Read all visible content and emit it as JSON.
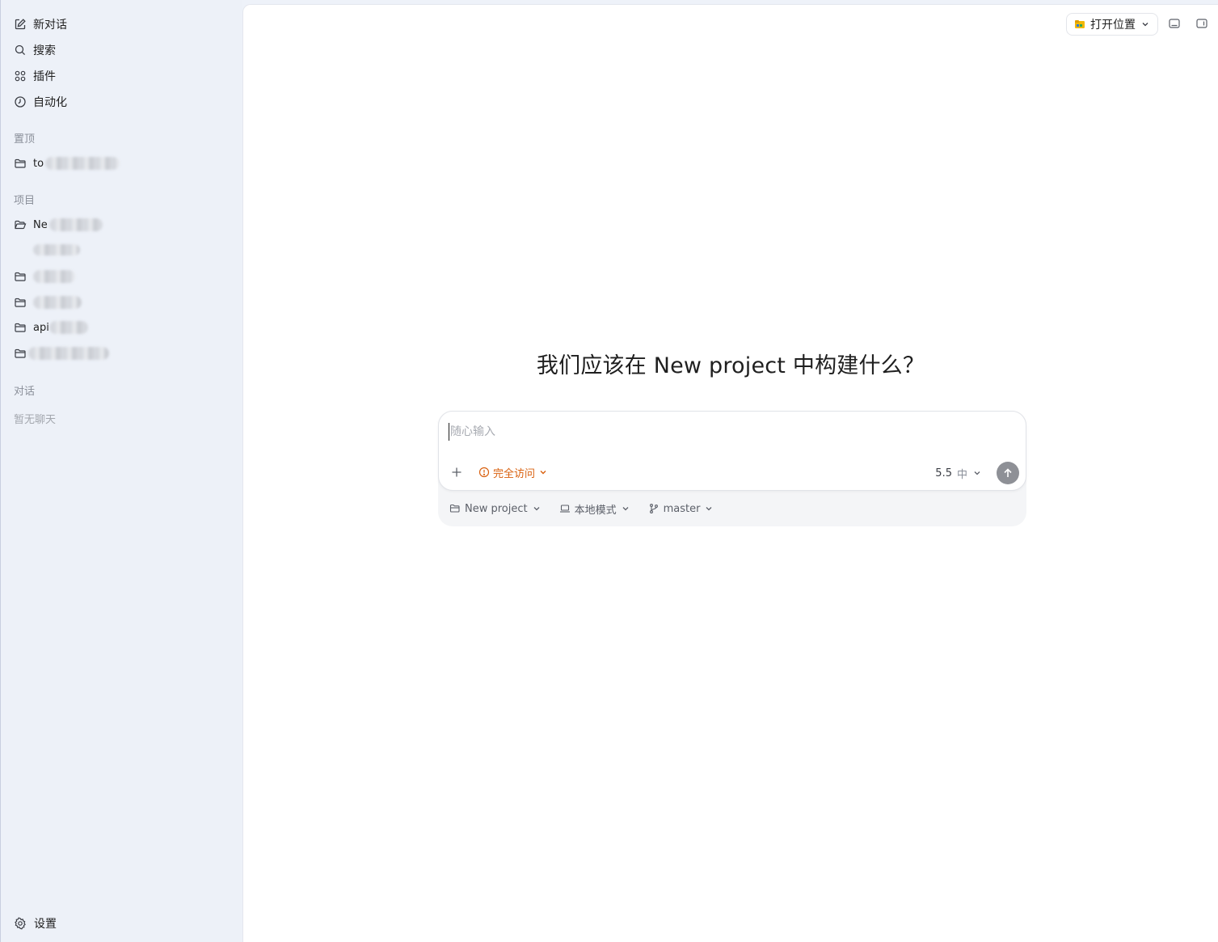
{
  "sidebar": {
    "nav": [
      {
        "label": "新对话",
        "icon": "edit-icon"
      },
      {
        "label": "搜索",
        "icon": "search-icon"
      },
      {
        "label": "插件",
        "icon": "plugins-icon"
      },
      {
        "label": "自动化",
        "icon": "clock-icon"
      }
    ],
    "pinned_label": "置顶",
    "pinned": [
      {
        "label": "to"
      }
    ],
    "projects_label": "项目",
    "projects": [
      {
        "label": "Ne"
      },
      {
        "label": ""
      },
      {
        "label": ""
      },
      {
        "label": "api"
      },
      {
        "label": ""
      }
    ],
    "chats_label": "对话",
    "chats_empty": "暂无聊天",
    "settings_label": "设置"
  },
  "topbar": {
    "open_location_label": "打开位置"
  },
  "main": {
    "headline": "我们应该在 New project 中构建什么？",
    "composer": {
      "placeholder": "随心输入",
      "access_label": "完全访问",
      "model_version": "5.5",
      "model_effort": "中"
    },
    "footer": {
      "project": "New project",
      "mode": "本地模式",
      "branch": "master"
    }
  },
  "colors": {
    "accent_warning": "#d9600e",
    "sidebar_bg": "#edf1f8",
    "send_button": "#8e9096"
  }
}
